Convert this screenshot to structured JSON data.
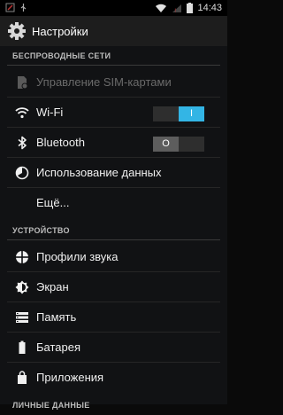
{
  "status_bar": {
    "time": "14:43"
  },
  "action_bar": {
    "title": "Настройки"
  },
  "sections": {
    "wireless": {
      "header": "БЕСПРОВОДНЫЕ СЕТИ",
      "items": [
        {
          "label": "Управление SIM-картами",
          "icon": "sim-icon",
          "enabled": false
        },
        {
          "label": "Wi-Fi",
          "icon": "wifi-icon",
          "toggle": "I",
          "toggle_state": "on"
        },
        {
          "label": "Bluetooth",
          "icon": "bluetooth-icon",
          "toggle": "O",
          "toggle_state": "off"
        },
        {
          "label": "Использование данных",
          "icon": "data-usage-icon"
        },
        {
          "label": "Ещё...",
          "icon": ""
        }
      ]
    },
    "device": {
      "header": "УСТРОЙСТВО",
      "items": [
        {
          "label": "Профили звука",
          "icon": "sound-profiles-icon"
        },
        {
          "label": "Экран",
          "icon": "display-icon"
        },
        {
          "label": "Память",
          "icon": "storage-icon"
        },
        {
          "label": "Батарея",
          "icon": "battery-icon"
        },
        {
          "label": "Приложения",
          "icon": "apps-icon"
        }
      ]
    },
    "personal": {
      "header": "ЛИЧНЫЕ ДАННЫЕ"
    }
  },
  "colors": {
    "accent": "#33b5e5",
    "background": "#111214",
    "action_bar": "#1d1d1d",
    "status_bar": "#000000"
  }
}
